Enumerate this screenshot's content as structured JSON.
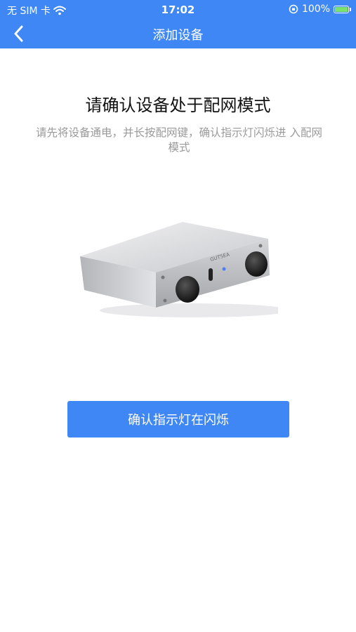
{
  "status_bar": {
    "carrier": "无 SIM 卡",
    "time": "17:02",
    "battery": "100%"
  },
  "nav": {
    "title": "添加设备",
    "back_icon": "chevron-left-icon"
  },
  "main": {
    "heading": "请确认设备处于配网模式",
    "description": "请先将设备通电，并长按配网键，确认指示灯闪烁进 入配网模式",
    "device_brand": "GUTSEA"
  },
  "button": {
    "label": "确认指示灯在闪烁"
  },
  "colors": {
    "primary": "#3f87f5",
    "heading": "#111111",
    "description": "#9a9a9a"
  }
}
